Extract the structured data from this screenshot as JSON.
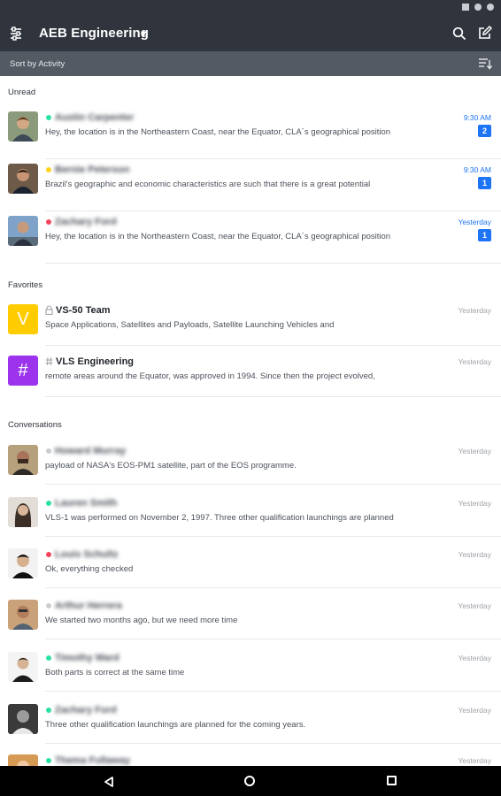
{
  "app": {
    "workspace_title": "AEB Engineering",
    "sort_label": "Sort by Activity"
  },
  "colors": {
    "header_bg": "#2f343d",
    "sortbar_bg": "#545a64",
    "accent": "#1d74f5",
    "online": "#2de0a5",
    "away": "#ffd21f",
    "busy": "#f5455c",
    "offline": "#cbced1",
    "channel_v": "#ffcc00",
    "channel_vls": "#9b34ec"
  },
  "sections": {
    "unread": "Unread",
    "favorites": "Favorites",
    "conversations": "Conversations"
  },
  "unread": [
    {
      "name": "Austin Carpenter",
      "status": "online",
      "message": "Hey, the location is in the Northeastern Coast, near the Equator, CLA´s geographical position",
      "time": "9:30 AM",
      "badge": "2",
      "avatar_icon": "user-avatar"
    },
    {
      "name": "Bernie Peterson",
      "status": "away",
      "message": "Brazil's geographic and economic characteristics are such that there is a great potential",
      "time": "9:30 AM",
      "badge": "1",
      "avatar_icon": "user-avatar"
    },
    {
      "name": "Zachary Ford",
      "status": "busy",
      "message": "Hey, the location is in the Northeastern Coast, near the Equator, CLA´s geographical position",
      "time": "Yesterday",
      "badge": "1",
      "avatar_icon": "user-avatar"
    }
  ],
  "favorites": [
    {
      "name": "VS-50 Team",
      "letter": "V",
      "icon": "lock-icon",
      "message": "Space Applications, Satellites and Payloads, Satellite Launching Vehicles and",
      "time": "Yesterday"
    },
    {
      "name": "VLS Engineering",
      "letter": "#",
      "icon": "hashtag-icon",
      "message": "remote areas around the Equator, was approved in 1994. Since then the project evolved,",
      "time": "Yesterday"
    }
  ],
  "conversations": [
    {
      "name": "Howard Murray",
      "status": "offline",
      "message": "payload of NASA's EOS-PM1 satellite, part of the EOS programme.",
      "time": "Yesterday"
    },
    {
      "name": "Lauren Smith",
      "status": "online",
      "message": "VLS-1 was performed on November 2, 1997. Three other qualification launchings are planned",
      "time": "Yesterday"
    },
    {
      "name": "Louis Schultz",
      "status": "busy",
      "message": "Ok, everything checked",
      "time": "Yesterday"
    },
    {
      "name": "Arthur Herrera",
      "status": "offline",
      "message": "We started two months ago, but we need more time",
      "time": "Yesterday"
    },
    {
      "name": "Timothy Ward",
      "status": "online",
      "message": "Both parts is correct at the same time",
      "time": "Yesterday"
    },
    {
      "name": "Zachary Ford",
      "status": "online",
      "message": "Three other qualification launchings are planned for the coming years.",
      "time": "Yesterday"
    },
    {
      "name": "Thema Fullaway",
      "status": "online",
      "message": "",
      "time": "Yesterday"
    }
  ]
}
